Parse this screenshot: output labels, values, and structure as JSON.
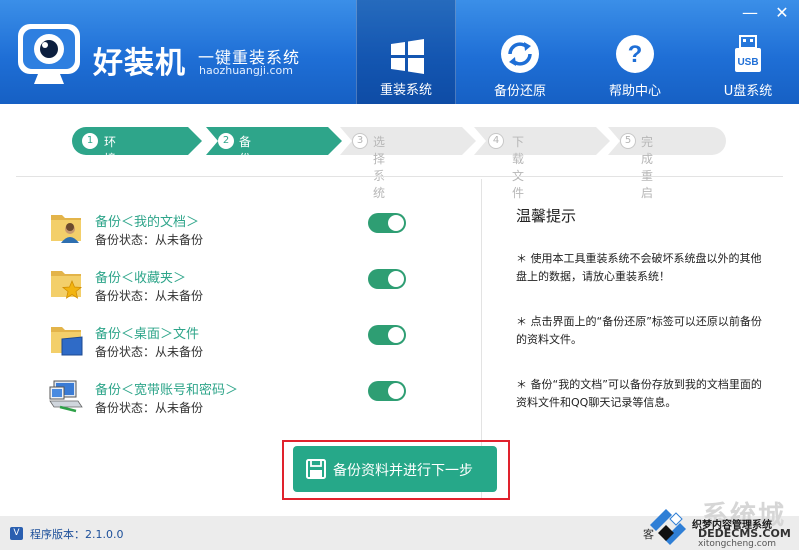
{
  "app": {
    "brand": "好装机",
    "slogan": "一键重装系统",
    "domain": "haozhuangji.com",
    "minimize": "—",
    "close": "✕"
  },
  "nav": [
    {
      "label": "重装系统",
      "icon": "windows-icon",
      "active": true
    },
    {
      "label": "备份还原",
      "icon": "refresh-icon",
      "active": false
    },
    {
      "label": "帮助中心",
      "icon": "help-icon",
      "active": false
    },
    {
      "label": "U盘系统",
      "icon": "usb-icon",
      "active": false
    }
  ],
  "steps": [
    {
      "num": "1",
      "label": "环境检测",
      "state": "done"
    },
    {
      "num": "2",
      "label": "备份资料",
      "state": "done"
    },
    {
      "num": "3",
      "label": "选择系统",
      "state": "todo"
    },
    {
      "num": "4",
      "label": "下载文件",
      "state": "todo"
    },
    {
      "num": "5",
      "label": "完成重启",
      "state": "todo"
    }
  ],
  "backups": [
    {
      "title": "备份＜我的文档＞",
      "status": "备份状态：从未备份",
      "enabled": true,
      "icon": "documents-folder-icon"
    },
    {
      "title": "备份＜收藏夹＞",
      "status": "备份状态：从未备份",
      "enabled": true,
      "icon": "favorites-folder-icon"
    },
    {
      "title": "备份＜桌面＞文件",
      "status": "备份状态：从未备份",
      "enabled": true,
      "icon": "desktop-folder-icon"
    },
    {
      "title": "备份＜宽带账号和密码＞",
      "status": "备份状态：从未备份",
      "enabled": true,
      "icon": "network-icon"
    }
  ],
  "tips": {
    "title": "温馨提示",
    "items": [
      "＊ 使用本工具重装系统不会破坏系统盘以外的其他盘上的数据，请放心重装系统！",
      "＊ 点击界面上的“备份还原”标签可以还原以前备份的资料文件。",
      "＊ 备份“我的文档”可以备份存放到我的文档里面的资料文件和QQ聊天记录等信息。"
    ]
  },
  "action": {
    "label": "备份资料并进行下一步"
  },
  "footer": {
    "badge": "V",
    "version": "程序版本：2.1.0.0",
    "right": "客"
  },
  "watermark": {
    "cn": "系统城",
    "line1": "织梦内容管理系统",
    "line2": "DEDECMS.COM",
    "line3": "xitongcheng.com"
  },
  "colors": {
    "header": "#1f6fd6",
    "accent": "#26a889",
    "toggle": "#2e9e73",
    "highlight_frame": "#e0222d"
  }
}
